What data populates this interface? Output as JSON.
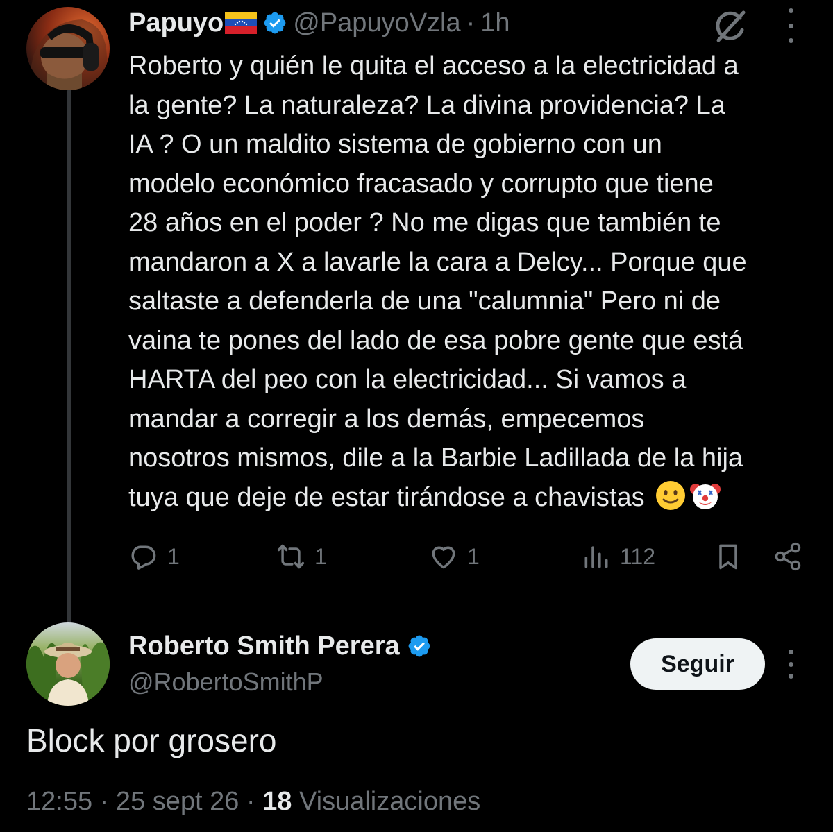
{
  "reply": {
    "author_name": "Papuyo",
    "author_flag": "venezuela-flag",
    "handle": "@PapuyoVzla",
    "separator": "·",
    "time": "1h",
    "verified": true,
    "text_lines": [
      "Roberto y quién le quita el acceso a la electricidad a",
      "la gente?  La naturaleza? La divina providencia? La",
      "IA ? O un maldito sistema de gobierno con un",
      "modelo económico fracasado y corrupto que tiene",
      "28 años en el poder ?  No me digas que también te",
      "mandaron a X a lavarle la cara a Delcy... Porque que",
      "saltaste a defenderla de una \"calumnia\" Pero ni de",
      "vaina te pones del lado de esa pobre gente que está",
      "HARTA del peo con la electricidad... Si vamos a",
      "mandar a corregir a los demás, empecemos",
      "nosotros mismos, dile a la Barbie Ladillada de la hija",
      "tuya que deje de estar tirándose a chavistas"
    ],
    "trailing_emojis": [
      "slightly-smiling-face",
      "clown-face"
    ],
    "stats": {
      "replies": "1",
      "reposts": "1",
      "likes": "1",
      "views": "112"
    }
  },
  "main": {
    "author_name": "Roberto Smith Perera",
    "handle": "@RobertoSmithP",
    "verified": true,
    "follow_label": "Seguir",
    "text": "Block por grosero",
    "time": "12:55",
    "date": "25 sept 26",
    "sep": "·",
    "views_count": "18",
    "views_label": "Visualizaciones"
  },
  "colors": {
    "background": "#000000",
    "text": "#e7e9ea",
    "muted": "#71767b",
    "verified_blue": "#1d9bf0",
    "button_bg": "#eff3f4"
  }
}
